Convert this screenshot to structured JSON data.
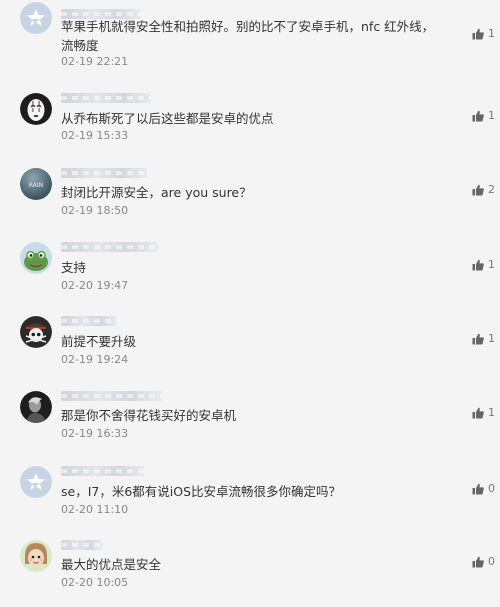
{
  "comments": [
    {
      "text": "苹果手机就得安全性和拍照好。别的比不了安卓手机，nfc 红外线，流畅度",
      "time": "02-19 22:21",
      "likes": "1",
      "avatar": "default-avatar-icon"
    },
    {
      "text": "从乔布斯死了以后这些都是安卓的优点",
      "time": "02-19 15:33",
      "likes": "1",
      "avatar": "no-face-avatar"
    },
    {
      "text": "封闭比开源安全，are you sure？",
      "time": "02-19 18:50",
      "likes": "2",
      "avatar": "rain-avatar"
    },
    {
      "text": "支持",
      "time": "02-20 19:47",
      "likes": "1",
      "avatar": "frog-avatar"
    },
    {
      "text": "前提不要升级",
      "time": "02-19 19:24",
      "likes": "1",
      "avatar": "pirate-skull-avatar"
    },
    {
      "text": "那是你不舍得花钱买好的安卓机",
      "time": "02-19 16:33",
      "likes": "1",
      "avatar": "dark-portrait-avatar"
    },
    {
      "text": "se，I7，米6都有说iOS比安卓流畅很多你确定吗？",
      "time": "02-20 11:10",
      "likes": "0",
      "avatar": "default-avatar-icon"
    },
    {
      "text": "最大的优点是安全",
      "time": "02-20 10:05",
      "likes": "0",
      "avatar": "doll-avatar"
    }
  ],
  "colors": {
    "background": "#f4f4f4",
    "text": "#333333",
    "time": "#888888",
    "like_icon": "#666666"
  }
}
